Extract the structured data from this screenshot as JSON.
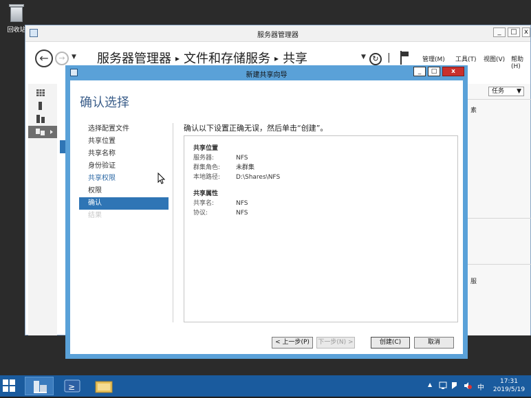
{
  "desktop": {
    "recycle_bin_label": "回收站"
  },
  "server_manager": {
    "title": "服务器管理器",
    "breadcrumb": [
      "服务器管理器",
      "文件和存储服务",
      "共享"
    ],
    "menus": [
      "管理(M)",
      "工具(T)",
      "视图(V)",
      "帮助(H)"
    ],
    "tasks_label": "任务",
    "fragment_text_1": "素",
    "fragment_text_2": "服",
    "icons": [
      "back-icon",
      "forward-icon",
      "refresh-icon",
      "flag-icon",
      "dashboard-icon",
      "local-server-icon",
      "all-servers-icon",
      "file-storage-icon"
    ]
  },
  "wizard": {
    "title": "新建共享向导",
    "heading": "确认选择",
    "instruction": "确认以下设置正确无误，然后单击“创建”。",
    "steps": [
      {
        "label": "选择配置文件",
        "state": "normal"
      },
      {
        "label": "共享位置",
        "state": "normal"
      },
      {
        "label": "共享名称",
        "state": "normal"
      },
      {
        "label": "身份验证",
        "state": "normal"
      },
      {
        "label": "共享权限",
        "state": "link"
      },
      {
        "label": "权限",
        "state": "normal"
      },
      {
        "label": "确认",
        "state": "active"
      },
      {
        "label": "结果",
        "state": "disabled"
      }
    ],
    "location_section": {
      "title": "共享位置",
      "rows": [
        {
          "key": "服务器:",
          "value": "NFS"
        },
        {
          "key": "群集角色:",
          "value": "未群集"
        },
        {
          "key": "本地路径:",
          "value": "D:\\Shares\\NFS"
        }
      ]
    },
    "properties_section": {
      "title": "共享属性",
      "rows": [
        {
          "key": "共享名:",
          "value": "NFS"
        },
        {
          "key": "协议:",
          "value": "NFS"
        }
      ]
    },
    "buttons": {
      "prev": "< 上一步(P)",
      "next": "下一步(N) >",
      "create": "创建(C)",
      "cancel": "取消"
    }
  },
  "taskbar": {
    "clock_time": "17:31",
    "clock_date": "2019/5/19",
    "ime": "中"
  }
}
